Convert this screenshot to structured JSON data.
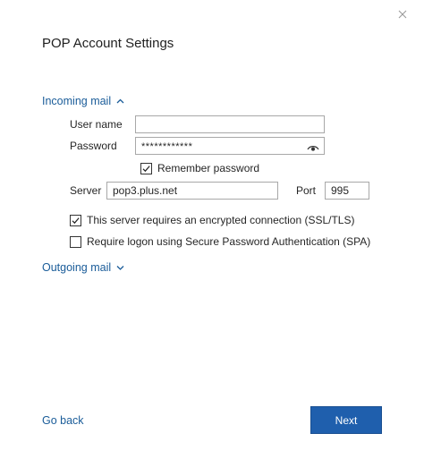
{
  "dialog": {
    "title": "POP Account Settings",
    "close_icon": "close-icon"
  },
  "incoming": {
    "toggle_label": "Incoming mail",
    "toggle_icon": "chevron-up-icon",
    "username_label": "User name",
    "username_value": "",
    "password_label": "Password",
    "password_value": "************",
    "password_icon": "eye-icon",
    "remember_label": "Remember password",
    "remember_checked": true,
    "server_label": "Server",
    "server_value": "pop3.plus.net",
    "port_label": "Port",
    "port_value": "995",
    "ssl_label": "This server requires an encrypted connection (SSL/TLS)",
    "ssl_checked": true,
    "spa_label": "Require logon using Secure Password Authentication (SPA)",
    "spa_checked": false
  },
  "outgoing": {
    "toggle_label": "Outgoing mail",
    "toggle_icon": "chevron-down-icon"
  },
  "footer": {
    "back_label": "Go back",
    "next_label": "Next"
  },
  "colors": {
    "link": "#1a5c99",
    "primary_button": "#1f5fad"
  }
}
